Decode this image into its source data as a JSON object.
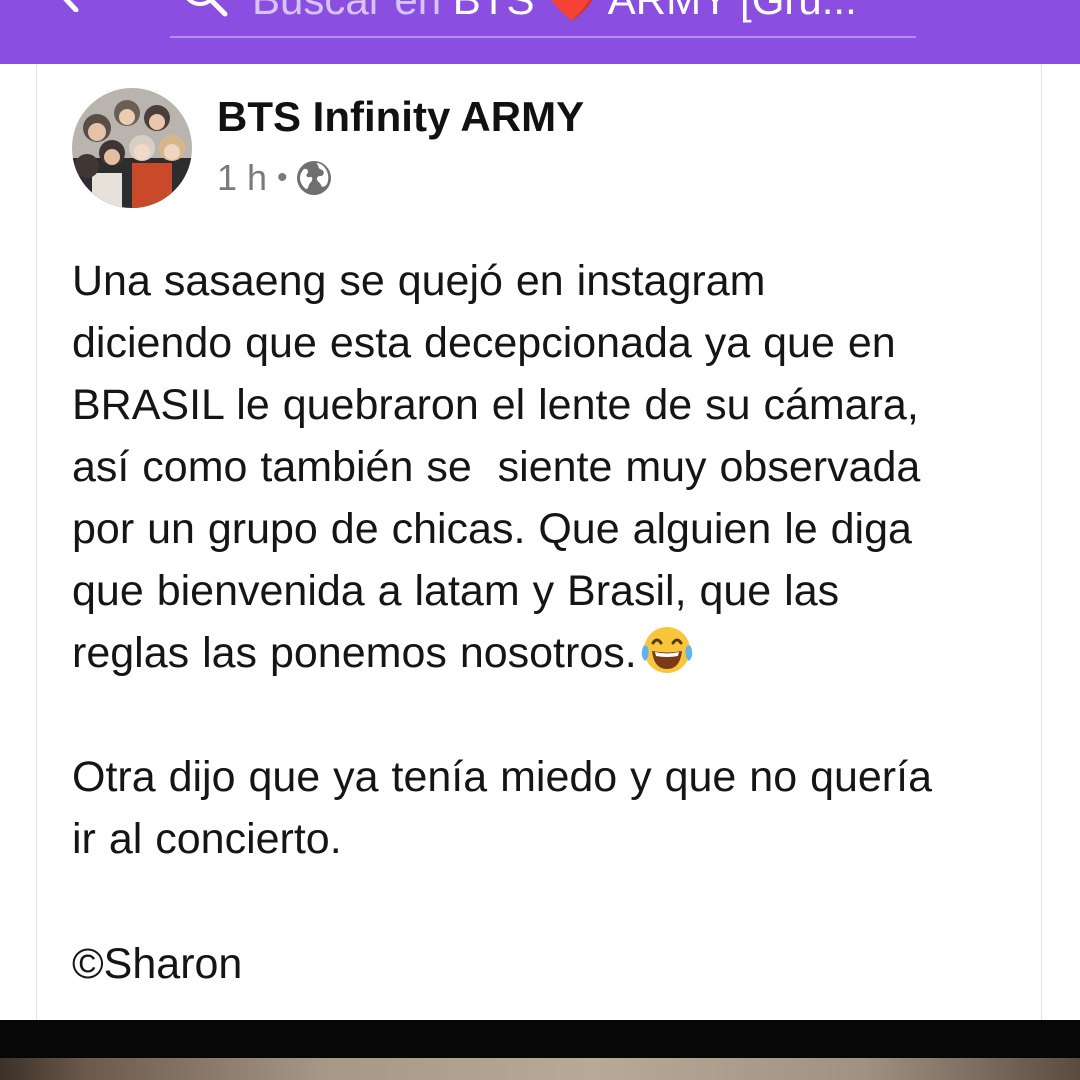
{
  "header": {
    "search_prefix": "Buscar en",
    "search_group_start": "BTS",
    "search_heart": "❤️",
    "search_group_end": "ARMY [Gru...",
    "accent_color": "#8a4fe0"
  },
  "post": {
    "author": "BTS Infinity ARMY",
    "time": "1 h",
    "separator": "•",
    "privacy_icon": "globe-icon",
    "body_main": "Una sasaeng se quejó en instagram\ndiciendo que esta decepcionada ya que en\nBRASIL le quebraron el lente de su cámara,\nasí como también se  siente muy observada\npor un grupo de chicas. Que alguien le diga\nque bienvenida a latam y Brasil, que las\nreglas las ponemos nosotros.",
    "emoji": "face-with-tears-of-joy",
    "body_after": "\n\nOtra dijo que ya tenía miedo y que no quería\nir al concierto.",
    "signature": "©Sharon"
  }
}
